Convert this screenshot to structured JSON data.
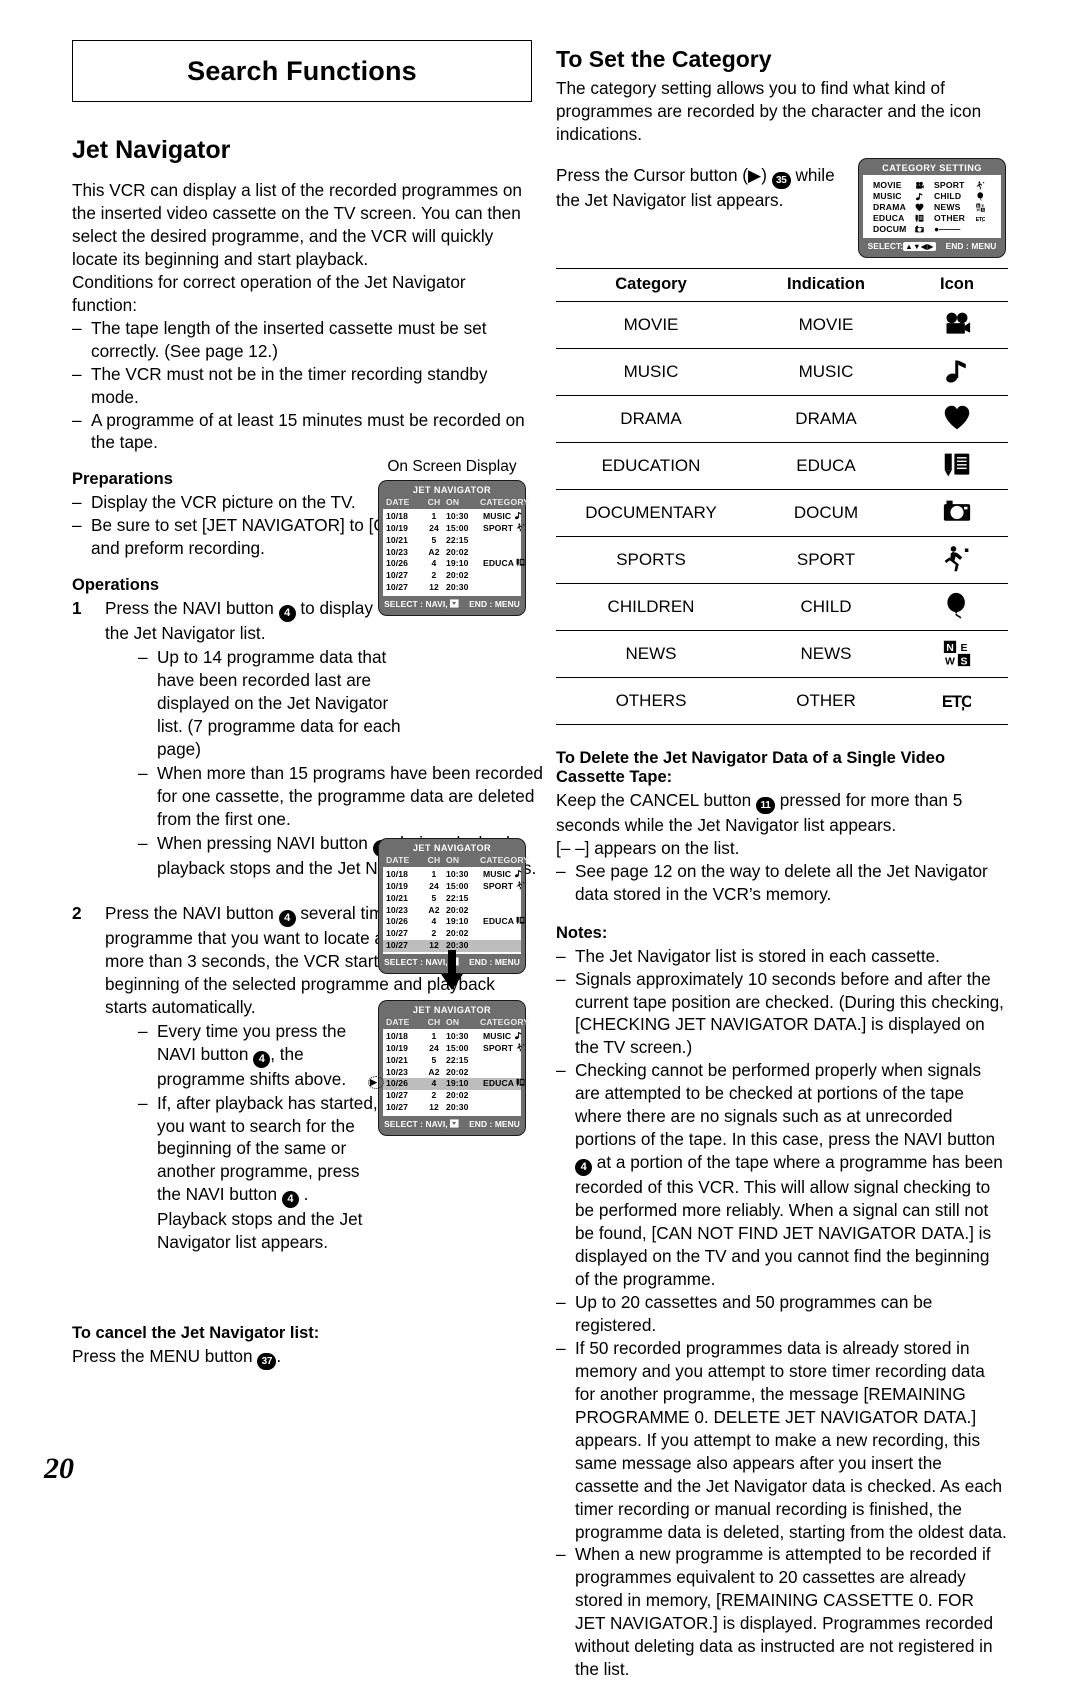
{
  "page_number": "20",
  "chapter_title": "Search Functions",
  "left": {
    "section_title": "Jet Navigator",
    "intro": "This VCR can display a list of the recorded programmes on the inserted video cassette on the TV screen. You can then select the desired programme, and the VCR will quickly locate its beginning and start playback.",
    "conditions_lead": "Conditions for correct operation of the Jet Navigator function:",
    "conditions": [
      "The tape length of the inserted cassette must be set correctly. (See page 12.)",
      "The VCR must not be in the timer recording standby mode.",
      "A programme of at least 15 minutes must be recorded on the tape."
    ],
    "preparations_title": "Preparations",
    "preparations": [
      "Display the VCR picture on the TV.",
      "Be sure to set [JET NAVIGATOR] to [ON] (see page 12) and preform recording."
    ],
    "operations_title": "Operations",
    "step1_pre": "Press the NAVI button ",
    "step1_badge": "4",
    "step1_post": " to display the Jet Navigator list.",
    "step1_subs": [
      "Up to 14 programme data that have been recorded last are displayed on the Jet Navigator list. (7 programme data for each page)",
      "When more than 15 programs have been recorded for one cassette, the programme data are deleted from the first one."
    ],
    "step1_sub3_a": "When pressing NAVI button ",
    "step1_sub3_b": " during playback, playback stops and the Jet Navigator list appears.",
    "step2_pre": "Press the NAVI button ",
    "step2_post": " several times to select the programme that you want to locate and play back. After more than 3 seconds, the VCR starts the search for the beginning of the selected programme and playback starts automatically.",
    "step2_sub1_a": "Every time you press the NAVI button ",
    "step2_sub1_b": ", the programme shifts above.",
    "step2_sub2_a": "If, after playback has started, you want to search for the beginning of the same or another programme, press the NAVI button ",
    "step2_sub2_b": " .",
    "step2_sub2_c": "Playback stops and the Jet Navigator list appears.",
    "cancel_title": "To cancel the Jet Navigator list:",
    "cancel_text_pre": "Press the MENU button ",
    "cancel_badge": "37",
    "cancel_text_post": "."
  },
  "osd_caption": "On Screen Display",
  "jet_navigator_osd": {
    "title": "JET NAVIGATOR",
    "columns": [
      "DATE",
      "CH",
      "ON",
      "CATEGORY"
    ],
    "rows": [
      {
        "date": "10/18",
        "ch": "1",
        "on": "10:30",
        "category": "MUSIC",
        "icon": "music-note-icon"
      },
      {
        "date": "10/19",
        "ch": "24",
        "on": "15:00",
        "category": "SPORT",
        "icon": "sports-icon"
      },
      {
        "date": "10/21",
        "ch": "5",
        "on": "22:15",
        "category": "",
        "icon": ""
      },
      {
        "date": "10/23",
        "ch": "A2",
        "on": "20:02",
        "category": "",
        "icon": ""
      },
      {
        "date": "10/26",
        "ch": "4",
        "on": "19:10",
        "category": "EDUCA",
        "icon": "education-icon"
      },
      {
        "date": "10/27",
        "ch": "2",
        "on": "20:02",
        "category": "",
        "icon": ""
      },
      {
        "date": "10/27",
        "ch": "12",
        "on": "20:30",
        "category": "",
        "icon": ""
      }
    ],
    "footer_select": "SELECT : NAVI,",
    "footer_end": "END : MENU"
  },
  "category_setting_osd": {
    "title": "CATEGORY SETTING",
    "left_items": [
      {
        "label": "MOVIE",
        "icon": "movie-camera-icon"
      },
      {
        "label": "MUSIC",
        "icon": "music-note-icon"
      },
      {
        "label": "DRAMA",
        "icon": "heart-icon"
      },
      {
        "label": "EDUCA",
        "icon": "education-icon"
      },
      {
        "label": "DOCUM",
        "icon": "camera-icon"
      }
    ],
    "right_items": [
      {
        "label": "SPORT",
        "icon": "sports-icon"
      },
      {
        "label": "CHILD",
        "icon": "balloon-icon"
      },
      {
        "label": "NEWS",
        "icon": "news-icon"
      },
      {
        "label": "OTHER",
        "icon": "etc-icon"
      },
      {
        "label": "",
        "icon": "dash-line"
      }
    ],
    "dash_line": "●–––––",
    "footer_select": "SELECT:",
    "footer_cursor": "▲▼◀▶",
    "footer_end": "END : MENU"
  },
  "right": {
    "section_title": "To Set the Category",
    "intro": "The category setting allows you to find what kind of programmes are recorded by the character and the icon indications.",
    "press_pre": "Press the Cursor button (",
    "press_arrow": "▶",
    "press_mid": ") ",
    "press_badge": "35",
    "press_post": " while the Jet Navigator list appears.",
    "table": {
      "headers": [
        "Category",
        "Indication",
        "Icon"
      ],
      "rows": [
        {
          "category": "MOVIE",
          "indication": "MOVIE",
          "icon": "movie-camera-icon"
        },
        {
          "category": "MUSIC",
          "indication": "MUSIC",
          "icon": "music-note-icon"
        },
        {
          "category": "DRAMA",
          "indication": "DRAMA",
          "icon": "heart-icon"
        },
        {
          "category": "EDUCATION",
          "indication": "EDUCA",
          "icon": "education-icon"
        },
        {
          "category": "DOCUMENTARY",
          "indication": "DOCUM",
          "icon": "camera-icon"
        },
        {
          "category": "SPORTS",
          "indication": "SPORT",
          "icon": "sports-icon"
        },
        {
          "category": "CHILDREN",
          "indication": "CHILD",
          "icon": "balloon-icon"
        },
        {
          "category": "NEWS",
          "indication": "NEWS",
          "icon": "news-icon"
        },
        {
          "category": "OTHERS",
          "indication": "OTHER",
          "icon": "etc-icon"
        }
      ]
    },
    "delete_title_l1": "To Delete the Jet Navigator Data of a Single Video",
    "delete_title_l2": "Cassette Tape:",
    "delete_pre": "Keep the CANCEL button ",
    "delete_badge": "11",
    "delete_post": " pressed for more than 5 seconds while the Jet Navigator list appears.",
    "delete_line3": "[– –] appears on the list.",
    "delete_bullet": "See page 12 on the way to delete all the Jet Navigator data stored in the VCR’s memory.",
    "notes_title": "Notes:",
    "notes": [
      "The Jet Navigator list is stored in each cassette.",
      "Signals approximately 10 seconds before and after the current tape position are checked. (During this checking, [CHECKING JET NAVIGATOR DATA.] is displayed on the TV screen.)"
    ],
    "note3_a": "Checking cannot be performed properly when signals are attempted to be checked at portions of the tape where there are no signals such as at unrecorded portions of the tape. In this case, press the NAVI button ",
    "note3_b": " at a portion of the tape where a programme has been recorded of this VCR. This will allow signal checking to be performed more reliably. When a signal can still not be found, [CAN NOT FIND JET NAVIGATOR DATA.] is displayed on the TV and you cannot find the beginning of the programme.",
    "notes_tail": [
      "Up to 20 cassettes and 50 programmes can be registered.",
      "If 50 recorded programmes data is already stored in memory and you attempt to store timer recording data for another programme, the message [REMAINING PROGRAMME  0. DELETE JET NAVIGATOR DATA.] appears. If you attempt to make a new recording, this same message also appears after you insert the cassette and the Jet Navigator data is checked. As each timer recording or manual recording is finished, the programme data is deleted, starting from the oldest data.",
      "When a new programme is attempted to be recorded if programmes equivalent to 20 cassettes are already stored in memory, [REMAINING CASSETTE  0. FOR JET NAVIGATOR.] is displayed. Programmes recorded without deleting data as instructed are not registered in the list."
    ]
  }
}
